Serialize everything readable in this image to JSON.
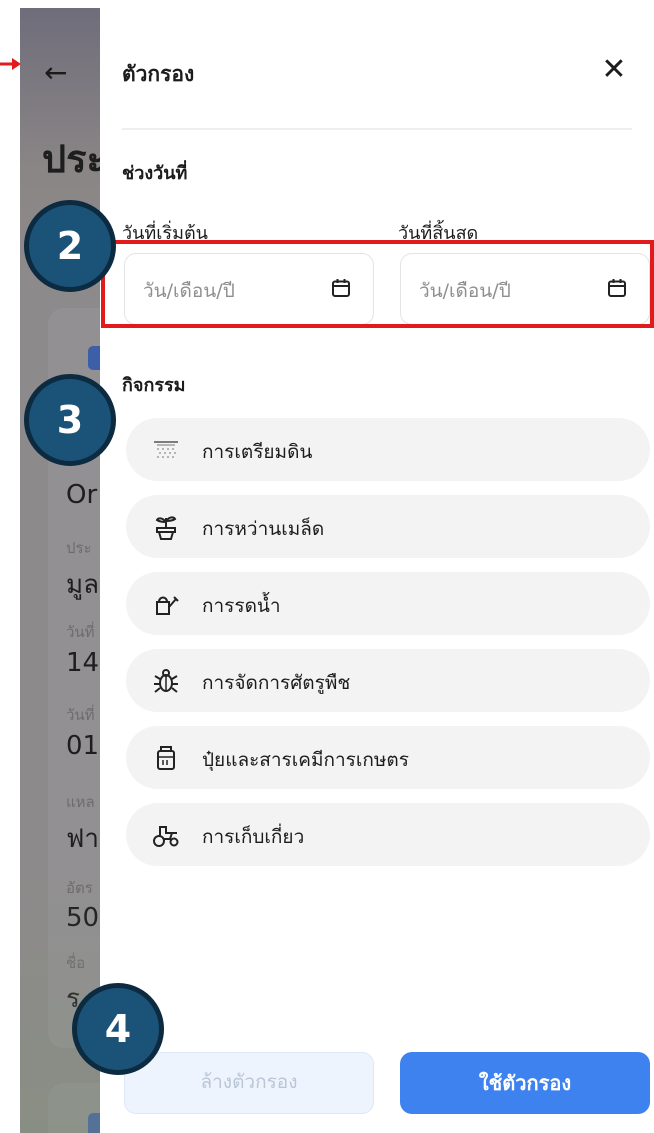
{
  "background_page": {
    "heading": "ประ",
    "card_lines": [
      {
        "text": "Or",
        "style": "big"
      },
      {
        "text": "ประ",
        "style": "small"
      },
      {
        "text": "มูล",
        "style": "big"
      },
      {
        "text": "วันที่",
        "style": "small"
      },
      {
        "text": "14,",
        "style": "big"
      },
      {
        "text": "วันที่",
        "style": "small"
      },
      {
        "text": "01,",
        "style": "big"
      },
      {
        "text": "แหล",
        "style": "small"
      },
      {
        "text": "ฟา",
        "style": "big"
      },
      {
        "text": "อัตร",
        "style": "small"
      },
      {
        "text": "50",
        "style": "big"
      },
      {
        "text": "ชื่อ",
        "style": "small"
      },
      {
        "text": "ร",
        "style": "big"
      }
    ]
  },
  "drawer": {
    "title": "ตัวกรอง",
    "date_section": {
      "title": "ช่วงวันที่",
      "start": {
        "label": "วันที่เริ่มต้น",
        "placeholder": "วัน/เดือน/ปี"
      },
      "end": {
        "label": "วันที่สิ้นสุด",
        "placeholder": "วัน/เดือน/ปี"
      }
    },
    "activity_section": {
      "title": "กิจกรรม",
      "items": [
        {
          "label": "การเตรียมดิน",
          "icon": "soil-prep-icon"
        },
        {
          "label": "การหว่านเมล็ด",
          "icon": "seedling-icon"
        },
        {
          "label": "การรดน้ำ",
          "icon": "watering-can-icon"
        },
        {
          "label": "การจัดการศัตรูพืช",
          "icon": "bug-icon"
        },
        {
          "label": "ปุ๋ยและสารเคมีการเกษตร",
          "icon": "fertilizer-icon"
        },
        {
          "label": "การเก็บเกี่ยว",
          "icon": "tractor-icon"
        }
      ]
    },
    "buttons": {
      "clear": "ล้างตัวกรอง",
      "apply": "ใช้ตัวกรอง"
    }
  },
  "tutorial": {
    "steps": [
      "2",
      "3",
      "4"
    ],
    "colors": {
      "highlight": "#e11b1b",
      "badge": "#1a5278",
      "apply": "#3d82ef"
    }
  }
}
